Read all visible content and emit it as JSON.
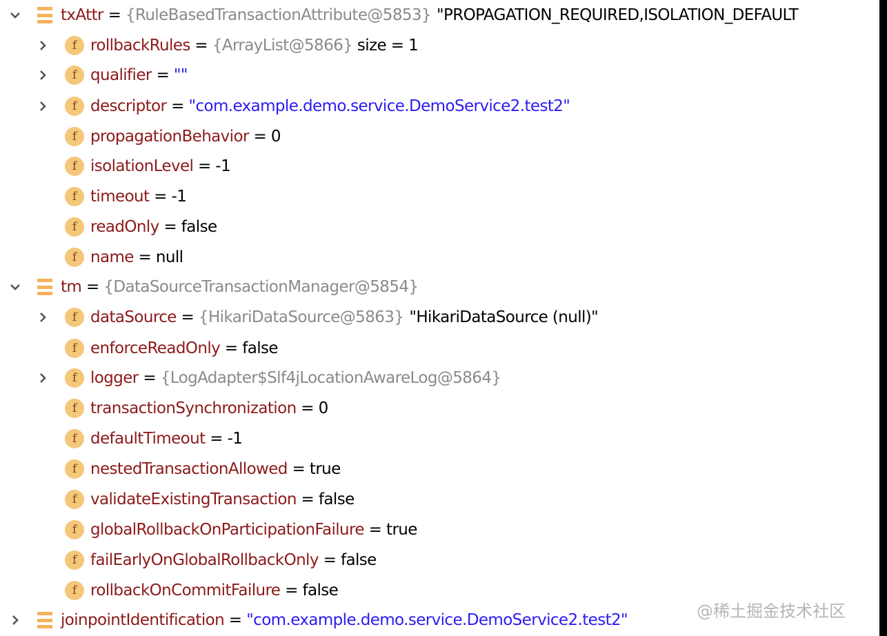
{
  "rows": [
    {
      "level": 0,
      "expander": "expanded",
      "icon": "list-icon",
      "name": "txAttr",
      "type": "{RuleBasedTransactionAttribute@5853}",
      "value": "\"PROPAGATION_REQUIRED,ISOLATION_DEFAULT",
      "value_kind": "plain"
    },
    {
      "level": 1,
      "expander": "collapsed",
      "icon": "field-icon",
      "name": "rollbackRules",
      "type": "{ArrayList@5866}",
      "value": " size = 1",
      "value_kind": "plain"
    },
    {
      "level": 1,
      "expander": "collapsed",
      "icon": "field-icon",
      "name": "qualifier",
      "type": "",
      "value": "\"\"",
      "value_kind": "string"
    },
    {
      "level": 1,
      "expander": "collapsed",
      "icon": "field-icon",
      "name": "descriptor",
      "type": "",
      "value": "\"com.example.demo.service.DemoService2.test2\"",
      "value_kind": "string"
    },
    {
      "level": 1,
      "expander": "none",
      "icon": "field-icon",
      "name": "propagationBehavior",
      "type": "",
      "value": "0",
      "value_kind": "plain"
    },
    {
      "level": 1,
      "expander": "none",
      "icon": "field-icon",
      "name": "isolationLevel",
      "type": "",
      "value": "-1",
      "value_kind": "plain"
    },
    {
      "level": 1,
      "expander": "none",
      "icon": "field-icon",
      "name": "timeout",
      "type": "",
      "value": "-1",
      "value_kind": "plain"
    },
    {
      "level": 1,
      "expander": "none",
      "icon": "field-icon",
      "name": "readOnly",
      "type": "",
      "value": "false",
      "value_kind": "plain"
    },
    {
      "level": 1,
      "expander": "none",
      "icon": "field-icon",
      "name": "name",
      "type": "",
      "value": "null",
      "value_kind": "plain"
    },
    {
      "level": 0,
      "expander": "expanded",
      "icon": "list-icon",
      "name": "tm",
      "type": "{DataSourceTransactionManager@5854}",
      "value": "",
      "value_kind": "plain"
    },
    {
      "level": 1,
      "expander": "collapsed",
      "icon": "field-icon",
      "name": "dataSource",
      "type": "{HikariDataSource@5863}",
      "value": "\"HikariDataSource (null)\"",
      "value_kind": "plain"
    },
    {
      "level": 1,
      "expander": "none",
      "icon": "field-icon",
      "name": "enforceReadOnly",
      "type": "",
      "value": "false",
      "value_kind": "plain"
    },
    {
      "level": 1,
      "expander": "collapsed",
      "icon": "field-icon",
      "name": "logger",
      "type": "{LogAdapter$Slf4jLocationAwareLog@5864}",
      "value": "",
      "value_kind": "plain"
    },
    {
      "level": 1,
      "expander": "none",
      "icon": "field-icon",
      "name": "transactionSynchronization",
      "type": "",
      "value": "0",
      "value_kind": "plain"
    },
    {
      "level": 1,
      "expander": "none",
      "icon": "field-icon",
      "name": "defaultTimeout",
      "type": "",
      "value": "-1",
      "value_kind": "plain"
    },
    {
      "level": 1,
      "expander": "none",
      "icon": "field-icon",
      "name": "nestedTransactionAllowed",
      "type": "",
      "value": "true",
      "value_kind": "plain"
    },
    {
      "level": 1,
      "expander": "none",
      "icon": "field-icon",
      "name": "validateExistingTransaction",
      "type": "",
      "value": "false",
      "value_kind": "plain"
    },
    {
      "level": 1,
      "expander": "none",
      "icon": "field-icon",
      "name": "globalRollbackOnParticipationFailure",
      "type": "",
      "value": "true",
      "value_kind": "plain"
    },
    {
      "level": 1,
      "expander": "none",
      "icon": "field-icon",
      "name": "failEarlyOnGlobalRollbackOnly",
      "type": "",
      "value": "false",
      "value_kind": "plain"
    },
    {
      "level": 1,
      "expander": "none",
      "icon": "field-icon",
      "name": "rollbackOnCommitFailure",
      "type": "",
      "value": "false",
      "value_kind": "plain"
    },
    {
      "level": 0,
      "expander": "collapsed",
      "icon": "list-icon",
      "name": "joinpointIdentification",
      "type": "",
      "value": "\"com.example.demo.service.DemoService2.test2\"",
      "value_kind": "string"
    }
  ],
  "equals": " = ",
  "field_icon_letter": "f",
  "watermark": "@稀土掘金技术社区",
  "colors": {
    "name": "#8b1a1a",
    "type": "#8a8a8a",
    "string": "#2b1cf0",
    "icon": "#f5c77a",
    "list_icon": "#f2b45c"
  }
}
